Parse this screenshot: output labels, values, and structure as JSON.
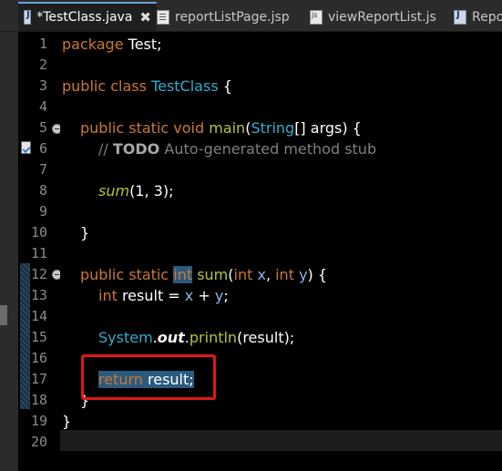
{
  "tabs": [
    {
      "label": "*TestClass.java",
      "icon": "java-file-icon",
      "active": true,
      "close": "✖"
    },
    {
      "label": "reportListPage.jsp",
      "icon": "jsp-file-icon",
      "active": false
    },
    {
      "label": "viewReportList.js",
      "icon": "js-file-icon",
      "active": false
    },
    {
      "label": "Repo",
      "icon": "java-file-icon",
      "active": false
    }
  ],
  "line_numbers": [
    "1",
    "2",
    "3",
    "4",
    "5",
    "6",
    "7",
    "8",
    "9",
    "10",
    "11",
    "12",
    "13",
    "14",
    "15",
    "16",
    "17",
    "18",
    "19",
    "20"
  ],
  "code": {
    "l1": {
      "kw": "package",
      "rest": " Test;"
    },
    "l3": {
      "kw": "public class",
      "cls": "TestClass",
      "rest": " {"
    },
    "l5": {
      "kw": "public static void",
      "mth": "main",
      "p1": "(",
      "cls": "String",
      "p2": "[] args) {"
    },
    "l6": {
      "slashes": "// ",
      "todo": "TODO",
      "rest": " Auto-generated method stub"
    },
    "l8": {
      "call": "sum",
      "args": "(1, 3);"
    },
    "l10": {
      "text": "}"
    },
    "l12": {
      "kw1": "public static",
      "sp": " ",
      "type": "int",
      "mth": "sum",
      "open": "(",
      "t1": "int",
      "x": "x",
      "comma": ", ",
      "t2": "int",
      "y": "y",
      "close": ") {"
    },
    "l13": {
      "type": "int",
      "rest1": " result = ",
      "x": "x",
      "plus": " + ",
      "y": "y",
      "semi": ";"
    },
    "l15": {
      "cls": "System",
      "dot1": ".",
      "out": "out",
      "dot2": ".",
      "mth": "println",
      "rest": "(result);"
    },
    "l17": {
      "kw": "return",
      "rest": " result;"
    },
    "l18": {
      "text": "}"
    },
    "l19": {
      "text": "}"
    }
  },
  "colors": {
    "accent": "#6aa0d8",
    "annotation_box": "#e01818",
    "keyword": "#cc7832",
    "class": "#2eadd0",
    "method": "#b4c43e"
  }
}
